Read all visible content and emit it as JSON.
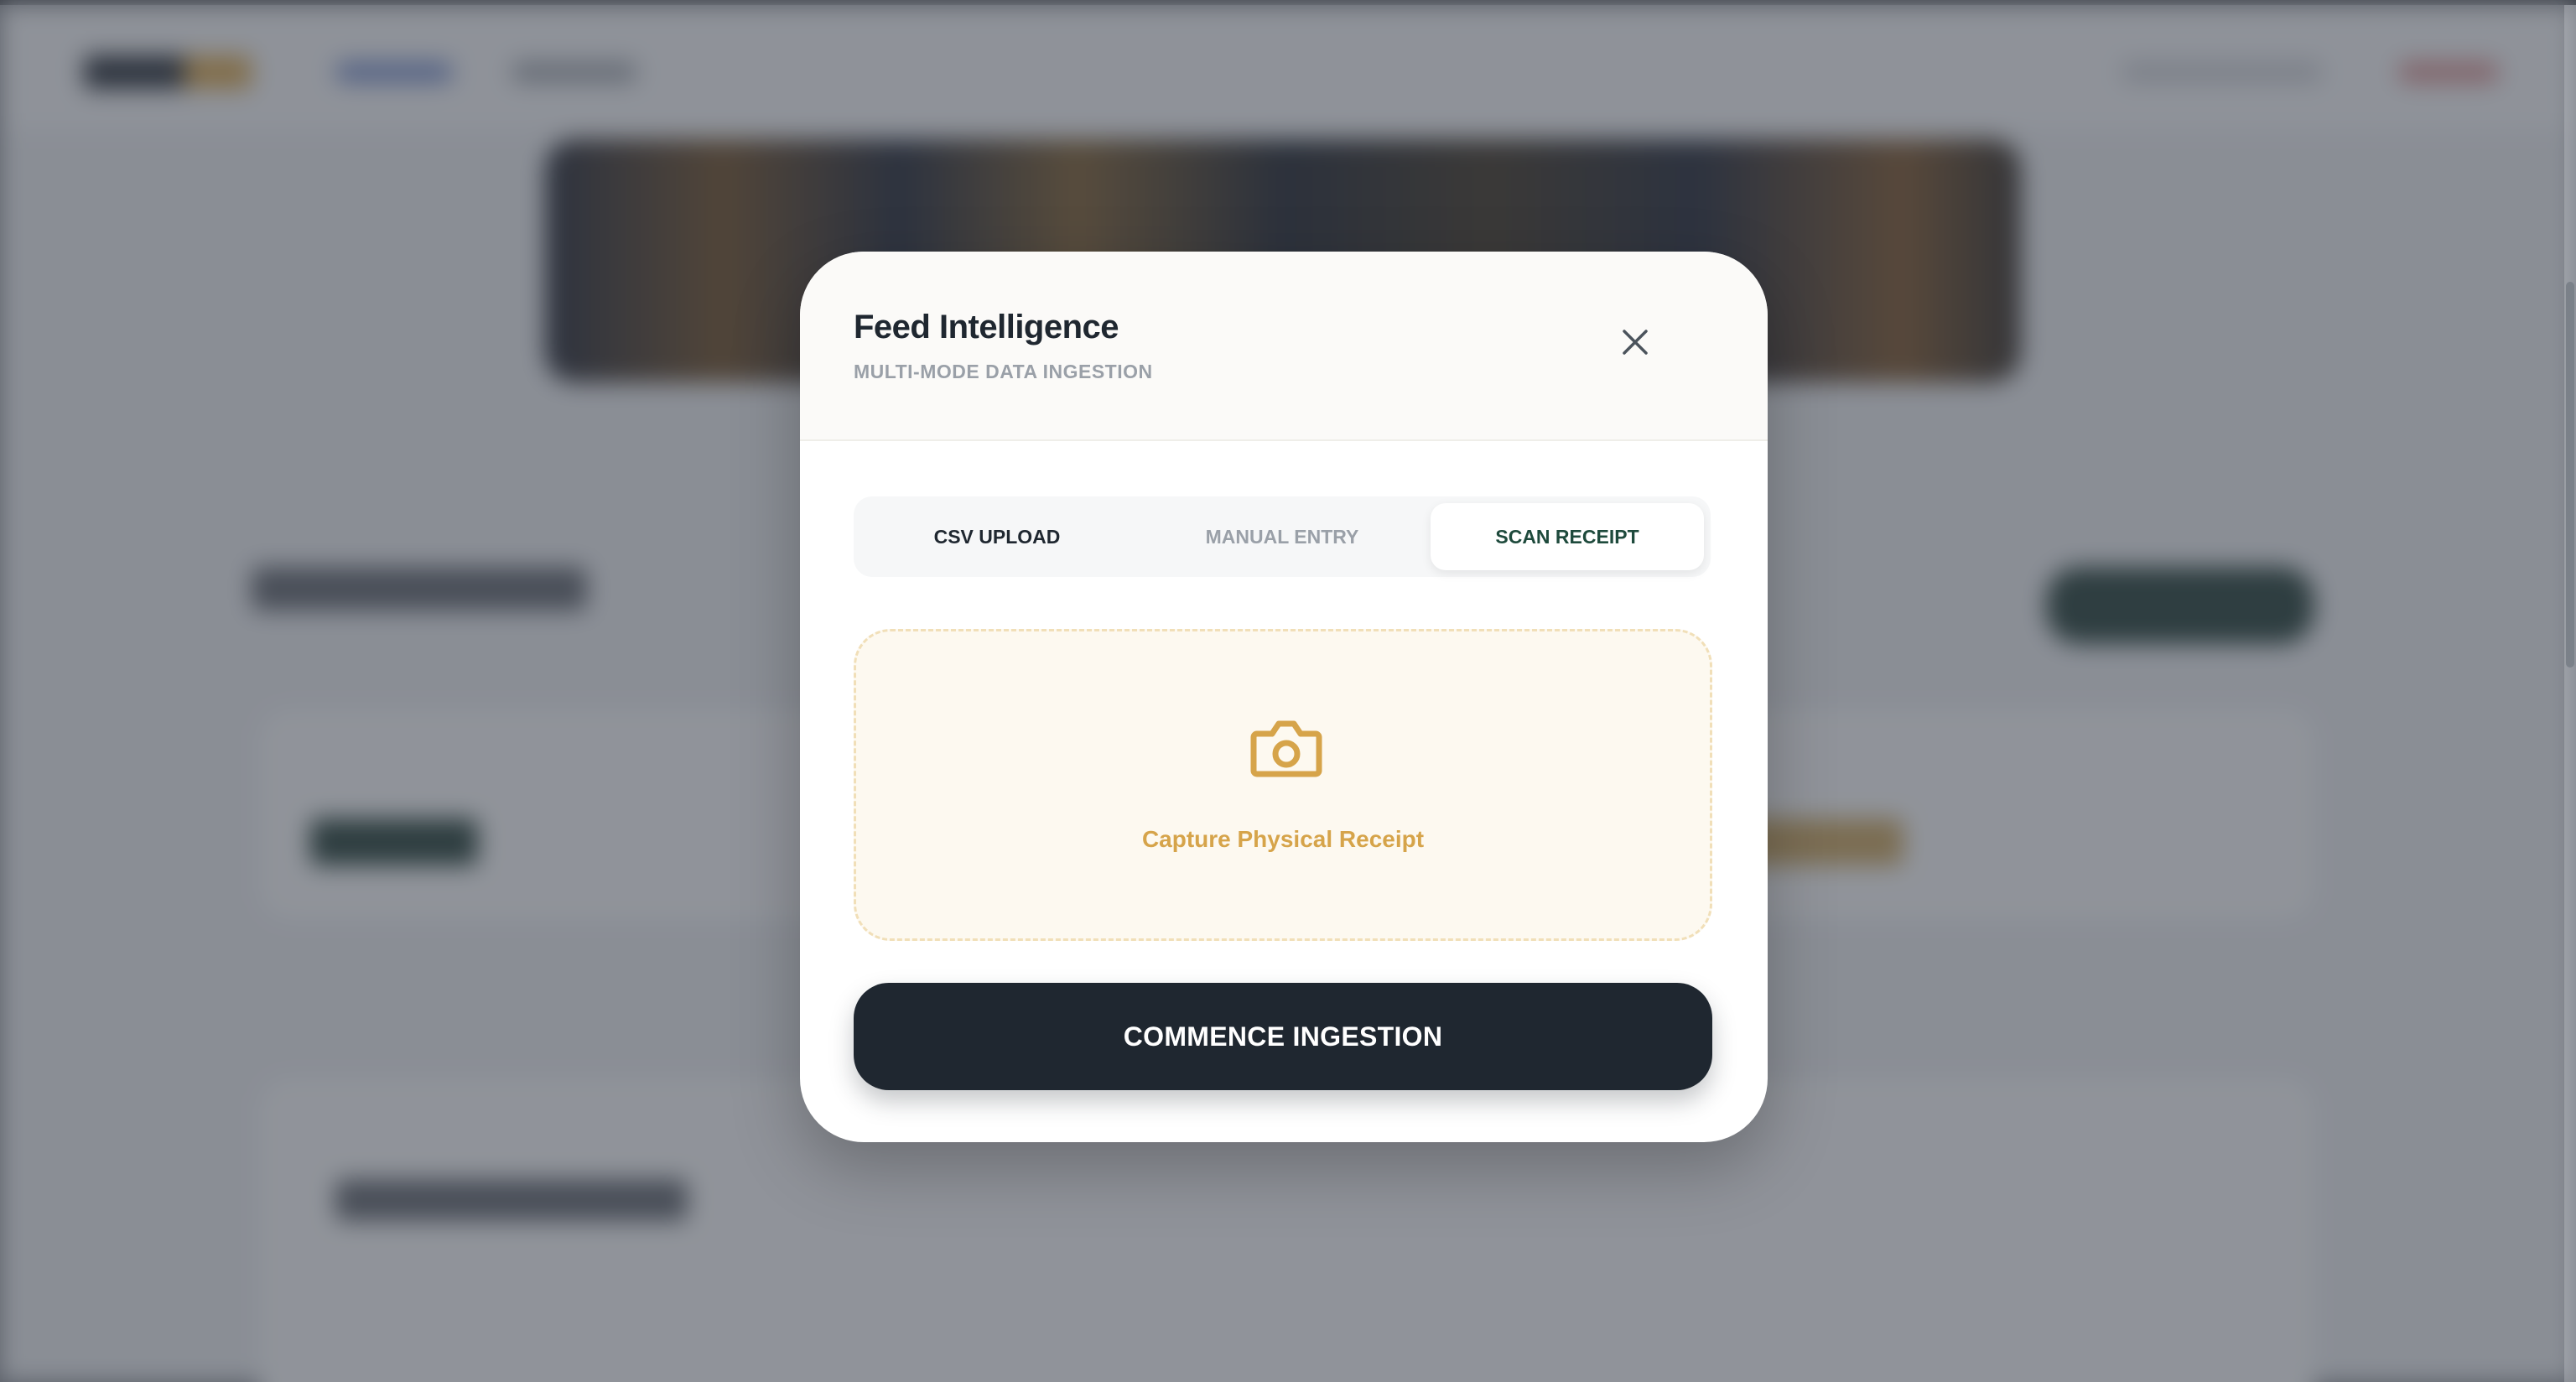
{
  "modal": {
    "title": "Feed Intelligence",
    "subtitle": "MULTI-MODE DATA INGESTION",
    "tabs": [
      {
        "label": "CSV UPLOAD",
        "active": false
      },
      {
        "label": "MANUAL ENTRY",
        "active": false
      },
      {
        "label": "SCAN RECEIPT",
        "active": true
      }
    ],
    "dropzone": {
      "icon": "camera-icon",
      "label": "Capture Physical Receipt"
    },
    "submit_label": "COMMENCE INGESTION"
  },
  "colors": {
    "accent_gold": "#d6a44a",
    "dark": "#1f2730",
    "active_tab_text": "#1e4a3c",
    "muted": "#9aa0a8"
  }
}
